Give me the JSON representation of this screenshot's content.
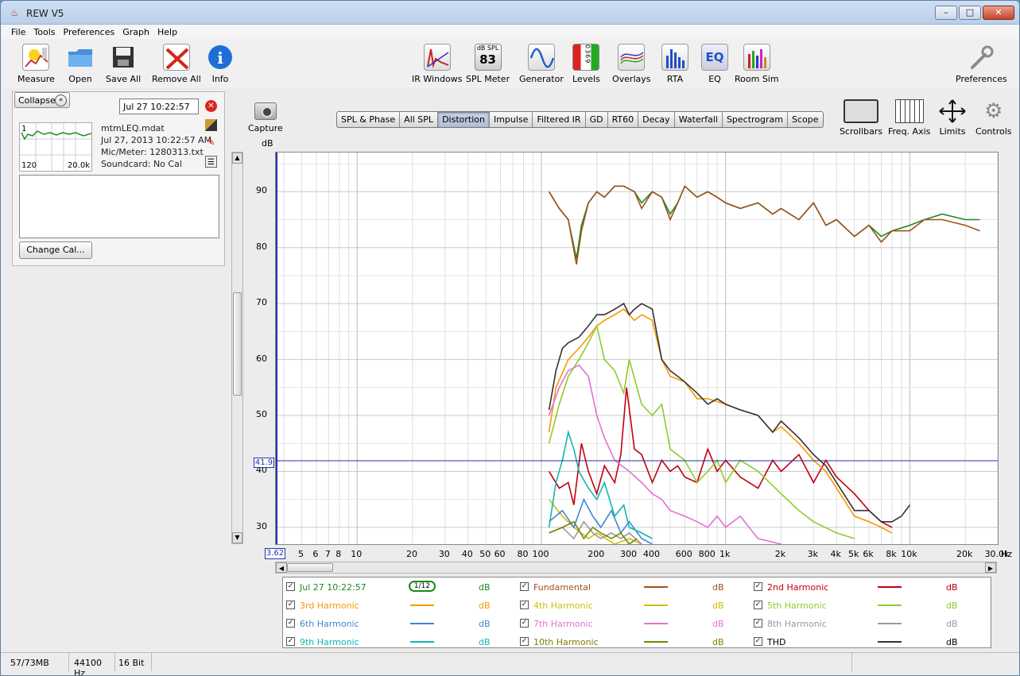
{
  "window": {
    "title": "REW V5",
    "min": "–",
    "max": "□",
    "close": "✕"
  },
  "menu": [
    "File",
    "Tools",
    "Preferences",
    "Graph",
    "Help"
  ],
  "toolbar": {
    "left": [
      {
        "label": "Measure",
        "icon": "measure-icon"
      },
      {
        "label": "Open",
        "icon": "folder-icon"
      },
      {
        "label": "Save All",
        "icon": "save-icon"
      },
      {
        "label": "Remove All",
        "icon": "remove-icon"
      },
      {
        "label": "Info",
        "icon": "info-icon"
      }
    ],
    "center": [
      {
        "label": "IR Windows",
        "icon": "ir-windows-icon"
      },
      {
        "label": "SPL Meter",
        "icon": "spl-meter-icon",
        "display_top": "dB SPL",
        "display_value": "83"
      },
      {
        "label": "Generator",
        "icon": "generator-icon"
      },
      {
        "label": "Levels",
        "icon": "levels-icon",
        "display_text": "0369"
      },
      {
        "label": "Overlays",
        "icon": "overlays-icon"
      },
      {
        "label": "RTA",
        "icon": "rta-icon"
      },
      {
        "label": "EQ",
        "icon": "eq-icon",
        "display_text": "EQ"
      },
      {
        "label": "Room Sim",
        "icon": "room-sim-icon"
      }
    ],
    "right": {
      "label": "Preferences",
      "icon": "wrench-icon"
    }
  },
  "left_panel": {
    "collapse_label": "Collapse",
    "collapse_glyph": "«",
    "timestamp": "Jul 27 10:22:57",
    "delete_glyph": "✕",
    "thumb_ticks": [
      "120",
      "20.0k"
    ],
    "thumb_one": "1",
    "info": [
      "mtmLEQ.mdat",
      "Jul 27, 2013 10:22:57 AM",
      "Mic/Meter: 1280313.txt",
      "Soundcard: No Cal"
    ],
    "change_cal_label": "Change Cal..."
  },
  "capture_label": "Capture",
  "tabs": [
    "SPL & Phase",
    "All SPL",
    "Distortion",
    "Impulse",
    "Filtered IR",
    "GD",
    "RT60",
    "Decay",
    "Waterfall",
    "Spectrogram",
    "Scope"
  ],
  "active_tab": "Distortion",
  "right_tools": [
    {
      "label": "Scrollbars",
      "icon": "scrollbars-icon"
    },
    {
      "label": "Freq. Axis",
      "icon": "freq-axis-icon"
    },
    {
      "label": "Limits",
      "icon": "limits-icon"
    },
    {
      "label": "Controls",
      "icon": "gear-icon"
    }
  ],
  "chart_data": {
    "type": "line",
    "ylabel": "dB",
    "xunit": "Hz",
    "x_scale": "log",
    "xlim": [
      3.62,
      30000
    ],
    "ylim": [
      27,
      97
    ],
    "y_ticks": [
      30,
      40,
      50,
      60,
      70,
      80,
      90
    ],
    "x_tick_labels": [
      {
        "v": 5,
        "t": "5"
      },
      {
        "v": 6,
        "t": "6"
      },
      {
        "v": 7,
        "t": "7"
      },
      {
        "v": 8,
        "t": "8"
      },
      {
        "v": 10,
        "t": "10"
      },
      {
        "v": 20,
        "t": "20"
      },
      {
        "v": 30,
        "t": "30"
      },
      {
        "v": 40,
        "t": "40"
      },
      {
        "v": 50,
        "t": "50"
      },
      {
        "v": 60,
        "t": "60"
      },
      {
        "v": 80,
        "t": "80"
      },
      {
        "v": 100,
        "t": "100"
      },
      {
        "v": 200,
        "t": "200"
      },
      {
        "v": 300,
        "t": "300"
      },
      {
        "v": 400,
        "t": "400"
      },
      {
        "v": 600,
        "t": "600"
      },
      {
        "v": 800,
        "t": "800"
      },
      {
        "v": 1000,
        "t": "1k"
      },
      {
        "v": 2000,
        "t": "2k"
      },
      {
        "v": 3000,
        "t": "3k"
      },
      {
        "v": 4000,
        "t": "4k"
      },
      {
        "v": 5000,
        "t": "5k"
      },
      {
        "v": 6000,
        "t": "6k"
      },
      {
        "v": 8000,
        "t": "8k"
      },
      {
        "v": 10000,
        "t": "10k"
      },
      {
        "v": 20000,
        "t": "20k"
      },
      {
        "v": 30000,
        "t": "30.0k"
      }
    ],
    "x_min_label": "3.62",
    "cursor_y": 41.9,
    "cursor_label": "41.9",
    "grid": true,
    "series": [
      {
        "name": "Jul 27 10:22:57",
        "color": "#1f8a1f",
        "x": [
          110,
          125,
          140,
          155,
          165,
          180,
          200,
          220,
          250,
          280,
          320,
          350,
          400,
          450,
          500,
          550,
          600,
          700,
          800,
          900,
          1000,
          1200,
          1500,
          1800,
          2000,
          2500,
          3000,
          3500,
          4000,
          5000,
          6000,
          7000,
          8000,
          10000,
          12000,
          15000,
          20000,
          24000
        ],
        "y": [
          90,
          87,
          85,
          78,
          84,
          88,
          90,
          89,
          91,
          91,
          90,
          88,
          90,
          89,
          86,
          88,
          91,
          89,
          90,
          89,
          88,
          87,
          88,
          86,
          87,
          85,
          88,
          84,
          85,
          82,
          84,
          82,
          83,
          84,
          85,
          86,
          85,
          85
        ]
      },
      {
        "name": "Fundamental",
        "color": "#a0521b",
        "x": [
          110,
          125,
          140,
          155,
          165,
          180,
          200,
          220,
          250,
          280,
          320,
          350,
          400,
          450,
          500,
          550,
          600,
          700,
          800,
          900,
          1000,
          1200,
          1500,
          1800,
          2000,
          2500,
          3000,
          3500,
          4000,
          5000,
          6000,
          7000,
          8000,
          10000,
          12000,
          15000,
          20000,
          24000
        ],
        "y": [
          90,
          87,
          85,
          77,
          83,
          88,
          90,
          89,
          91,
          91,
          90,
          87,
          90,
          89,
          85,
          88,
          91,
          89,
          90,
          89,
          88,
          87,
          88,
          86,
          87,
          85,
          88,
          84,
          85,
          82,
          84,
          81,
          83,
          83,
          85,
          85,
          84,
          83
        ]
      },
      {
        "name": "2nd Harmonic",
        "color": "#c0000d",
        "x": [
          110,
          125,
          140,
          150,
          165,
          180,
          200,
          220,
          250,
          270,
          290,
          320,
          350,
          400,
          450,
          500,
          550,
          600,
          700,
          800,
          900,
          1000,
          1200,
          1500,
          1800,
          2000,
          2500,
          3000,
          3500,
          4000,
          5000,
          6000,
          7000,
          8000
        ],
        "y": [
          40,
          37,
          38,
          34,
          45,
          40,
          36,
          41,
          38,
          43,
          55,
          44,
          43,
          38,
          42,
          40,
          41,
          39,
          38,
          44,
          40,
          42,
          39,
          37,
          42,
          40,
          43,
          38,
          42,
          39,
          36,
          33,
          31,
          30
        ]
      },
      {
        "name": "3rd Harmonic",
        "color": "#f59a00",
        "x": [
          110,
          120,
          140,
          160,
          180,
          200,
          220,
          250,
          280,
          320,
          350,
          400,
          450,
          500,
          600,
          700,
          800,
          1000,
          1200,
          1500,
          1800,
          2000,
          2500,
          3000,
          3500,
          4000,
          5000,
          6000,
          7000,
          8000
        ],
        "y": [
          47,
          55,
          60,
          62,
          64,
          66,
          67,
          68,
          69,
          67,
          68,
          67,
          60,
          57,
          56,
          53,
          53,
          52,
          51,
          50,
          47,
          48,
          45,
          42,
          40,
          37,
          32,
          31,
          30,
          29
        ]
      },
      {
        "name": "4th Harmonic",
        "color": "#c8c20a",
        "x": [
          110,
          130,
          150,
          180,
          200,
          250,
          300,
          350
        ],
        "y": [
          35,
          32,
          30,
          28,
          29,
          27,
          28,
          27
        ]
      },
      {
        "name": "5th Harmonic",
        "color": "#8fcc2b",
        "x": [
          110,
          125,
          140,
          160,
          180,
          200,
          220,
          250,
          280,
          300,
          350,
          400,
          450,
          500,
          600,
          700,
          800,
          900,
          1000,
          1200,
          1500,
          2000,
          2500,
          3000,
          4000,
          5000
        ],
        "y": [
          45,
          52,
          57,
          60,
          63,
          66,
          60,
          58,
          54,
          60,
          52,
          50,
          52,
          44,
          42,
          38,
          40,
          42,
          38,
          42,
          40,
          36,
          33,
          31,
          29,
          28
        ]
      },
      {
        "name": "6th Harmonic",
        "color": "#3f86d8",
        "x": [
          110,
          130,
          150,
          170,
          190,
          210,
          240,
          270,
          300,
          350,
          400
        ],
        "y": [
          31,
          33,
          30,
          35,
          32,
          30,
          33,
          29,
          31,
          28,
          27
        ]
      },
      {
        "name": "7th Harmonic",
        "color": "#e56fd6",
        "x": [
          110,
          125,
          140,
          160,
          180,
          200,
          220,
          250,
          300,
          350,
          400,
          450,
          500,
          600,
          700,
          800,
          900,
          1000,
          1200,
          1500,
          2000
        ],
        "y": [
          50,
          55,
          58,
          59,
          57,
          50,
          46,
          42,
          40,
          38,
          36,
          35,
          33,
          32,
          31,
          30,
          32,
          30,
          32,
          28,
          27
        ]
      },
      {
        "name": "8th Harmonic",
        "color": "#999999",
        "x": [
          110,
          130,
          150,
          170,
          190,
          210,
          240,
          270,
          300,
          350
        ],
        "y": [
          29,
          30,
          28,
          31,
          29,
          28,
          29,
          28,
          29,
          27
        ]
      },
      {
        "name": "9th Harmonic",
        "color": "#14b5b5",
        "x": [
          110,
          120,
          130,
          140,
          150,
          160,
          180,
          200,
          220,
          250,
          280,
          300,
          350,
          400
        ],
        "y": [
          30,
          38,
          42,
          47,
          44,
          40,
          37,
          35,
          38,
          32,
          34,
          30,
          29,
          28
        ]
      },
      {
        "name": "10th Harmonic",
        "color": "#7f7f00",
        "x": [
          110,
          130,
          150,
          170,
          190,
          210,
          240,
          270,
          300,
          330
        ],
        "y": [
          29,
          30,
          31,
          28,
          30,
          29,
          28,
          29,
          27,
          28
        ]
      },
      {
        "name": "THD",
        "color": "#333333",
        "x": [
          110,
          120,
          130,
          140,
          160,
          180,
          200,
          220,
          250,
          280,
          300,
          320,
          350,
          400,
          450,
          500,
          550,
          600,
          700,
          800,
          900,
          1000,
          1200,
          1500,
          1800,
          2000,
          2500,
          3000,
          3500,
          4000,
          5000,
          6000,
          7000,
          8000,
          9000,
          10000
        ],
        "y": [
          51,
          58,
          62,
          63,
          64,
          66,
          68,
          68,
          69,
          70,
          68,
          69,
          70,
          69,
          60,
          58,
          57,
          56,
          54,
          52,
          53,
          52,
          51,
          50,
          47,
          49,
          46,
          43,
          41,
          38,
          33,
          33,
          31,
          31,
          32,
          34
        ]
      }
    ]
  },
  "legend": {
    "db": "dB",
    "check_glyph": "✓",
    "smoothing_label": "1/12",
    "entries": [
      {
        "name": "Jul 27 10:22:57",
        "color": "#1f8a1f"
      },
      {
        "name": "Fundamental",
        "color": "#a0521b"
      },
      {
        "name": "2nd Harmonic",
        "color": "#c0000d"
      },
      {
        "name": "3rd Harmonic",
        "color": "#f59a00"
      },
      {
        "name": "4th Harmonic",
        "color": "#c8c20a"
      },
      {
        "name": "5th Harmonic",
        "color": "#8fcc2b"
      },
      {
        "name": "6th Harmonic",
        "color": "#3f86d8"
      },
      {
        "name": "7th Harmonic",
        "color": "#e56fd6"
      },
      {
        "name": "8th Harmonic",
        "color": "#999999"
      },
      {
        "name": "9th Harmonic",
        "color": "#14b5b5"
      },
      {
        "name": "10th Harmonic",
        "color": "#7f7f00"
      },
      {
        "name": "THD",
        "color": "#333333"
      }
    ]
  },
  "statusbar": {
    "memory": "57/73MB",
    "rate": "44100 Hz",
    "bits": "16 Bit"
  }
}
